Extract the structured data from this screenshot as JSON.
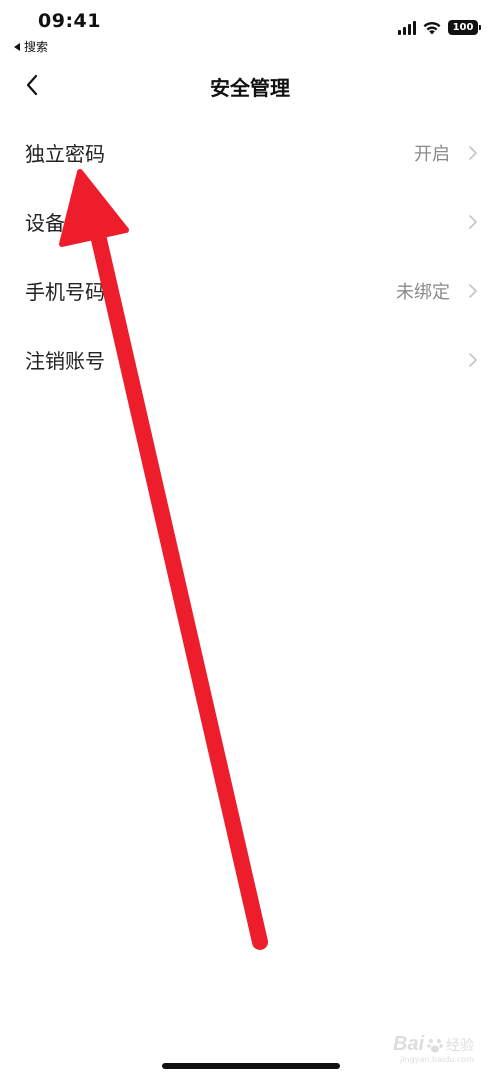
{
  "status_bar": {
    "time": "09:41",
    "back_app": "搜索",
    "battery": "100"
  },
  "nav": {
    "title": "安全管理"
  },
  "list": {
    "items": [
      {
        "label": "独立密码",
        "value": "开启"
      },
      {
        "label": "设备管理",
        "value": ""
      },
      {
        "label": "手机号码",
        "value": "未绑定"
      },
      {
        "label": "注销账号",
        "value": ""
      }
    ]
  },
  "annotation": {
    "arrow_color": "#ee1d2c"
  },
  "watermark": {
    "brand": "Bai",
    "suffix": "经验",
    "site": "jingyan.baidu.com"
  }
}
